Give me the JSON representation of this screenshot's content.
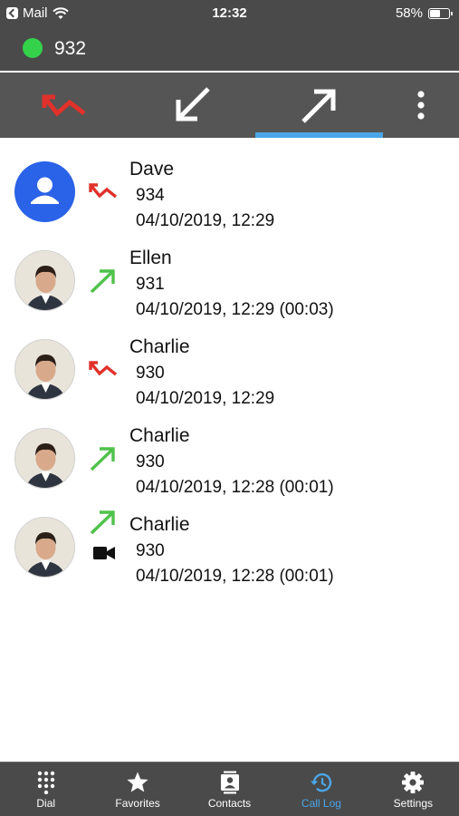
{
  "status_bar": {
    "back_app": "Mail",
    "time": "12:32",
    "battery_text": "58%",
    "battery_level": 0.58
  },
  "account": {
    "number": "932",
    "presence_color": "#34d24b"
  },
  "tabs": [
    {
      "name": "missed",
      "icon": "missed-call-icon",
      "color": "#e0312a"
    },
    {
      "name": "incoming",
      "icon": "incoming-call-icon",
      "color": "#ffffff"
    },
    {
      "name": "outgoing",
      "icon": "outgoing-call-icon",
      "color": "#ffffff",
      "selected": true
    }
  ],
  "accent_color": "#4aa6e8",
  "calls": [
    {
      "name": "Dave",
      "number": "934",
      "datetime": "04/10/2019, 12:29",
      "type": "missed",
      "avatar": "default"
    },
    {
      "name": "Ellen",
      "number": "931",
      "datetime": "04/10/2019, 12:29 (00:03)",
      "type": "outgoing",
      "avatar": "photo"
    },
    {
      "name": "Charlie",
      "number": "930",
      "datetime": "04/10/2019, 12:29",
      "type": "missed",
      "avatar": "photo"
    },
    {
      "name": "Charlie",
      "number": "930",
      "datetime": "04/10/2019, 12:28 (00:01)",
      "type": "outgoing",
      "avatar": "photo"
    },
    {
      "name": "Charlie",
      "number": "930",
      "datetime": "04/10/2019, 12:28 (00:01)",
      "type": "outgoing",
      "avatar": "photo",
      "video": true
    }
  ],
  "bottom_nav": [
    {
      "label": "Dial",
      "icon": "dialpad-icon"
    },
    {
      "label": "Favorites",
      "icon": "star-icon"
    },
    {
      "label": "Contacts",
      "icon": "contacts-icon"
    },
    {
      "label": "Call Log",
      "icon": "history-icon",
      "active": true
    },
    {
      "label": "Settings",
      "icon": "gear-icon"
    }
  ]
}
